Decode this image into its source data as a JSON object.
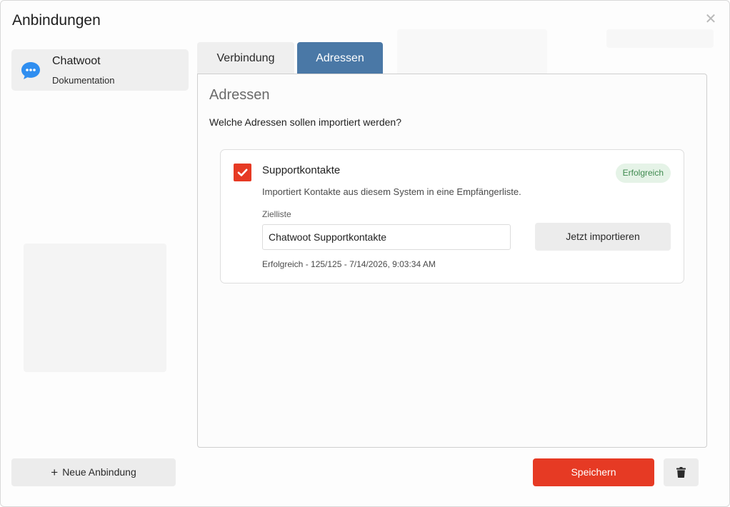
{
  "dialog": {
    "title": "Anbindungen",
    "close_icon": "close-icon"
  },
  "sidebar": {
    "items": [
      {
        "name": "Chatwoot",
        "subtitle": "Dokumentation",
        "icon": "chat-bubble-icon",
        "icon_color": "#2f8ef0"
      }
    ]
  },
  "tabs": [
    {
      "label": "Verbindung",
      "active": false
    },
    {
      "label": "Adressen",
      "active": true
    }
  ],
  "panel": {
    "title": "Adressen",
    "question": "Welche Adressen sollen importiert werden?",
    "card": {
      "checked": true,
      "heading": "Supportkontakte",
      "badge": "Erfolgreich",
      "description": "Importiert Kontakte aus diesem System in eine Empfängerliste.",
      "field_label": "Zielliste",
      "field_value": "Chatwoot Supportkontakte",
      "import_button": "Jetzt importieren",
      "status": "Erfolgreich - 125/125 - 7/14/2026, 9:03:34 AM"
    }
  },
  "footer": {
    "new_button": "Neue Anbindung",
    "save_button": "Speichern",
    "delete_icon": "trash-icon"
  },
  "colors": {
    "accent_red": "#e63a24",
    "tab_active": "#4a78a6",
    "badge_green": "#3f8a4f"
  }
}
